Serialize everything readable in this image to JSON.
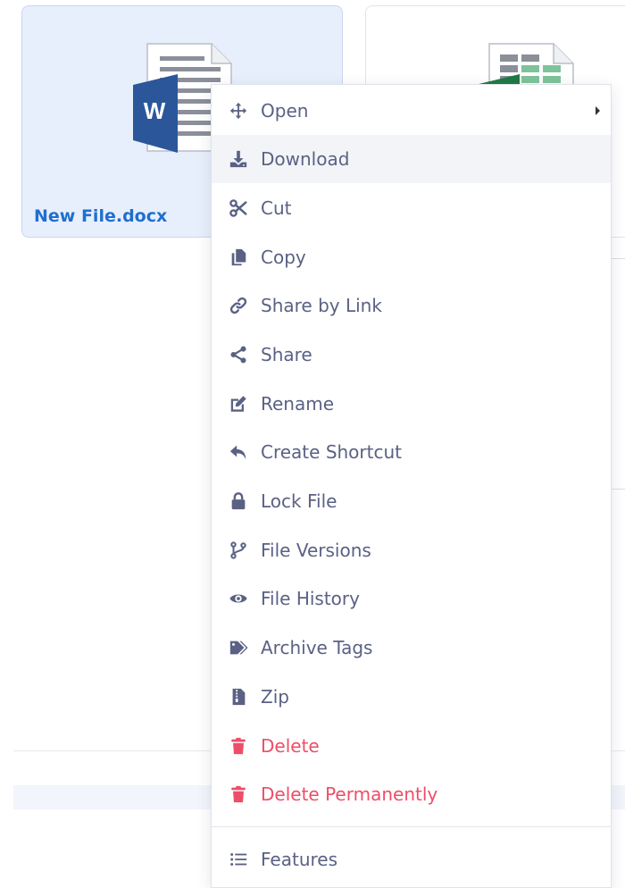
{
  "files": [
    {
      "name": "New File.docx",
      "icon": "word-document-icon",
      "selected": true
    },
    {
      "name": "",
      "icon": "excel-spreadsheet-icon",
      "selected": false
    }
  ],
  "menu": {
    "items": [
      {
        "label": "Open",
        "icon": "move-arrows-icon",
        "submenu": true
      },
      {
        "label": "Download",
        "icon": "download-icon",
        "hover": true
      },
      {
        "label": "Cut",
        "icon": "scissors-icon"
      },
      {
        "label": "Copy",
        "icon": "copy-icon"
      },
      {
        "label": "Share by Link",
        "icon": "link-icon"
      },
      {
        "label": "Share",
        "icon": "share-icon"
      },
      {
        "label": "Rename",
        "icon": "edit-icon"
      },
      {
        "label": "Create Shortcut",
        "icon": "reply-arrow-icon"
      },
      {
        "label": "Lock File",
        "icon": "lock-icon"
      },
      {
        "label": "File Versions",
        "icon": "branch-icon"
      },
      {
        "label": "File History",
        "icon": "eye-icon"
      },
      {
        "label": "Archive Tags",
        "icon": "tags-icon"
      },
      {
        "label": "Zip",
        "icon": "zip-file-icon"
      },
      {
        "label": "Delete",
        "icon": "trash-icon",
        "danger": true
      },
      {
        "label": "Delete Permanently",
        "icon": "trash-icon",
        "danger": true
      },
      {
        "label": "Features",
        "icon": "list-icon"
      }
    ]
  },
  "colors": {
    "menu_text": "#5a6184",
    "danger": "#ee4d68",
    "link": "#1f6fd0",
    "selected_card": "#e8effc",
    "word_blue": "#2b579a",
    "excel_green": "#1f7a45"
  }
}
